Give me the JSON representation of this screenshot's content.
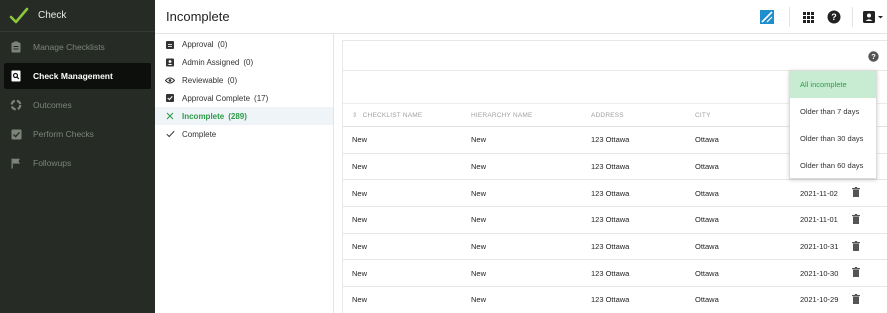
{
  "brand": {
    "name": "Check"
  },
  "sidebar": {
    "items": [
      {
        "label": "Manage Checklists",
        "icon": "clipboard-icon",
        "active": false
      },
      {
        "label": "Check Management",
        "icon": "search-doc-icon",
        "active": true
      },
      {
        "label": "Outcomes",
        "icon": "outcomes-icon",
        "active": false
      },
      {
        "label": "Perform Checks",
        "icon": "check-square-icon",
        "active": false
      },
      {
        "label": "Followups",
        "icon": "flag-icon",
        "active": false
      }
    ]
  },
  "header": {
    "title": "Incomplete"
  },
  "filters": [
    {
      "label": "Approval",
      "count": "(0)",
      "icon": "clipboard-icon",
      "active": false
    },
    {
      "label": "Admin Assigned",
      "count": "(0)",
      "icon": "user-badge-icon",
      "active": false
    },
    {
      "label": "Reviewable",
      "count": "(0)",
      "icon": "eye-icon",
      "active": false
    },
    {
      "label": "Approval Complete",
      "count": "(17)",
      "icon": "check-box-icon",
      "active": false
    },
    {
      "label": "Incomplete",
      "count": "(289)",
      "icon": "x-icon",
      "active": true
    },
    {
      "label": "Complete",
      "count": "",
      "icon": "check-icon",
      "active": false
    }
  ],
  "table": {
    "columns": [
      "CHECKLIST NAME",
      "HIERARCHY NAME",
      "ADDRESS",
      "CITY"
    ],
    "rows": [
      {
        "checklist": "New",
        "hierarchy": "New",
        "address": "123 Ottawa",
        "city": "Ottawa",
        "date": ""
      },
      {
        "checklist": "New",
        "hierarchy": "New",
        "address": "123 Ottawa",
        "city": "Ottawa",
        "date": ""
      },
      {
        "checklist": "New",
        "hierarchy": "New",
        "address": "123 Ottawa",
        "city": "Ottawa",
        "date": "2021-11-02"
      },
      {
        "checklist": "New",
        "hierarchy": "New",
        "address": "123 Ottawa",
        "city": "Ottawa",
        "date": "2021-11-01"
      },
      {
        "checklist": "New",
        "hierarchy": "New",
        "address": "123 Ottawa",
        "city": "Ottawa",
        "date": "2021-10-31"
      },
      {
        "checklist": "New",
        "hierarchy": "New",
        "address": "123 Ottawa",
        "city": "Ottawa",
        "date": "2021-10-30"
      },
      {
        "checklist": "New",
        "hierarchy": "New",
        "address": "123 Ottawa",
        "city": "Ottawa",
        "date": "2021-10-29"
      }
    ]
  },
  "dropdown": {
    "options": [
      "All incomplete",
      "Older than 7 days",
      "Older than 30 days",
      "Older than 60 days"
    ],
    "selected": "All incomplete"
  },
  "colors": {
    "accent": "#2e9c48",
    "sidebar_bg": "#262c25",
    "selected_bg": "#c8ecd2"
  }
}
